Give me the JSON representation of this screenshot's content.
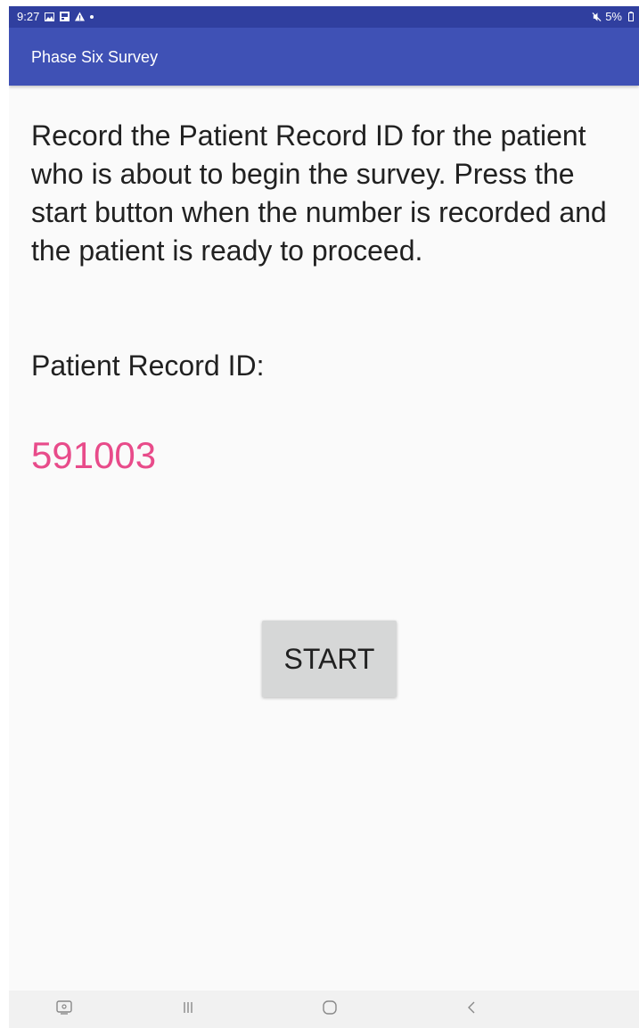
{
  "status_bar": {
    "time": "9:27",
    "battery": "5%",
    "notification_icons": [
      "gallery-icon",
      "image-icon",
      "alert-icon"
    ],
    "background_color": "#303f9f"
  },
  "app_bar": {
    "title": "Phase Six Survey",
    "background_color": "#3f51b5"
  },
  "main": {
    "instructions": "Record the Patient Record ID for the patient who is about to begin the survey. Press the start button when the number is recorded and the patient is ready to proceed.",
    "id_label": "Patient Record ID:",
    "id_value": "591003",
    "id_value_color": "#e84b8a",
    "start_label": "START"
  },
  "nav_bar": {
    "buttons": [
      "screenshot-icon",
      "recent-apps-icon",
      "home-icon",
      "back-icon"
    ]
  }
}
